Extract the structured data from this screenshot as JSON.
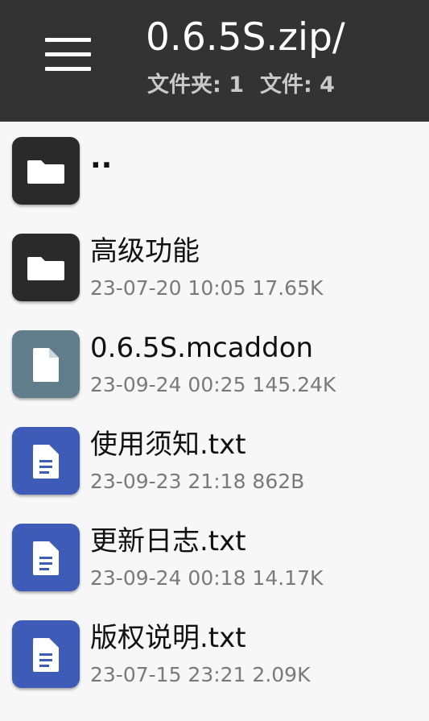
{
  "header": {
    "title": "0.6.5S.zip/",
    "folders_label": "文件夹: 1",
    "files_label": "文件: 4",
    "menu_icon": "hamburger-menu-icon",
    "background": "#333333"
  },
  "colors": {
    "folder_icon_bg": "#2a2a2a",
    "generic_file_icon_bg": "#607d8b",
    "text_file_icon_bg": "#3f5bb8"
  },
  "entries": [
    {
      "name": "..",
      "meta": "",
      "icon": "folder-icon"
    },
    {
      "name": "高级功能",
      "meta": "23-07-20 10:05  17.65K",
      "icon": "folder-icon"
    },
    {
      "name": "0.6.5S.mcaddon",
      "meta": "23-09-24 00:25  145.24K",
      "icon": "file-icon"
    },
    {
      "name": "使用须知.txt",
      "meta": "23-09-23 21:18  862B",
      "icon": "text-file-icon"
    },
    {
      "name": "更新日志.txt",
      "meta": "23-09-24 00:18  14.17K",
      "icon": "text-file-icon"
    },
    {
      "name": "版权说明.txt",
      "meta": "23-07-15 23:21  2.09K",
      "icon": "text-file-icon"
    }
  ]
}
